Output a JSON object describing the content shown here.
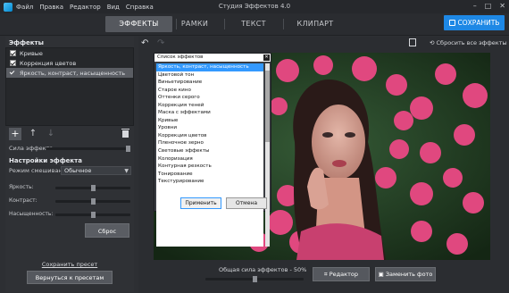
{
  "window": {
    "title": "Студия Эффектов 4.0",
    "controls": [
      "minimize-icon",
      "maximize-icon",
      "close-icon"
    ]
  },
  "menu": [
    "Файл",
    "Правка",
    "Редактор",
    "Вид",
    "Справка"
  ],
  "tabs": [
    {
      "label": "ЭФФЕКТЫ",
      "active": true
    },
    {
      "label": "РАМКИ",
      "active": false
    },
    {
      "label": "ТЕКСТ",
      "active": false
    },
    {
      "label": "КЛИПАРТ",
      "active": false
    }
  ],
  "save_button": "СОХРАНИТЬ",
  "effects": {
    "heading": "Эффекты",
    "items": [
      {
        "label": "Кривые",
        "checked": true,
        "selected": false
      },
      {
        "label": "Коррекция цветов",
        "checked": true,
        "selected": false
      },
      {
        "label": "Яркость, контраст, насыщенность",
        "checked": true,
        "selected": true
      }
    ]
  },
  "effect_strength_label": "Сила эффекта",
  "effect_strength_value": 1.0,
  "settings": {
    "heading": "Настройки эффекта",
    "blend_label": "Режим смешивания",
    "blend_value": "Обычное",
    "params": [
      {
        "label": "Яркость:",
        "value": 0.5
      },
      {
        "label": "Контраст:",
        "value": 0.5
      },
      {
        "label": "Насыщенность:",
        "value": 0.5
      }
    ],
    "reset_label": "Сброс"
  },
  "save_preset_link": "Сохранить пресет",
  "back_to_presets": "Вернуться к пресетам",
  "canvas_toolbar": {
    "reset_all": "Сбросить все эффекты"
  },
  "popup": {
    "title": "Список эффектов",
    "items": [
      "Яркость, контраст, насыщенность",
      "Цветовой тон",
      "Виньетирование",
      "Старое кино",
      "Оттенки серого",
      "Коррекция теней",
      "Маска с эффектами",
      "Кривые",
      "Уровни",
      "Коррекция цветов",
      "Пленочное зерно",
      "Световые эффекты",
      "Колоризация",
      "Контурная резкость",
      "Тонирование",
      "Текстурирование"
    ],
    "selected_index": 0,
    "apply": "Применить",
    "cancel": "Отмена"
  },
  "bottom": {
    "overall_strength": "Общая сила эффектов - 50%",
    "overall_value": 0.5,
    "editor_button": "Редактор",
    "replace_button": "Заменить фото"
  },
  "colors": {
    "accent": "#1e88e5",
    "selection": "#3399ff",
    "bg": "#2d2f33"
  }
}
